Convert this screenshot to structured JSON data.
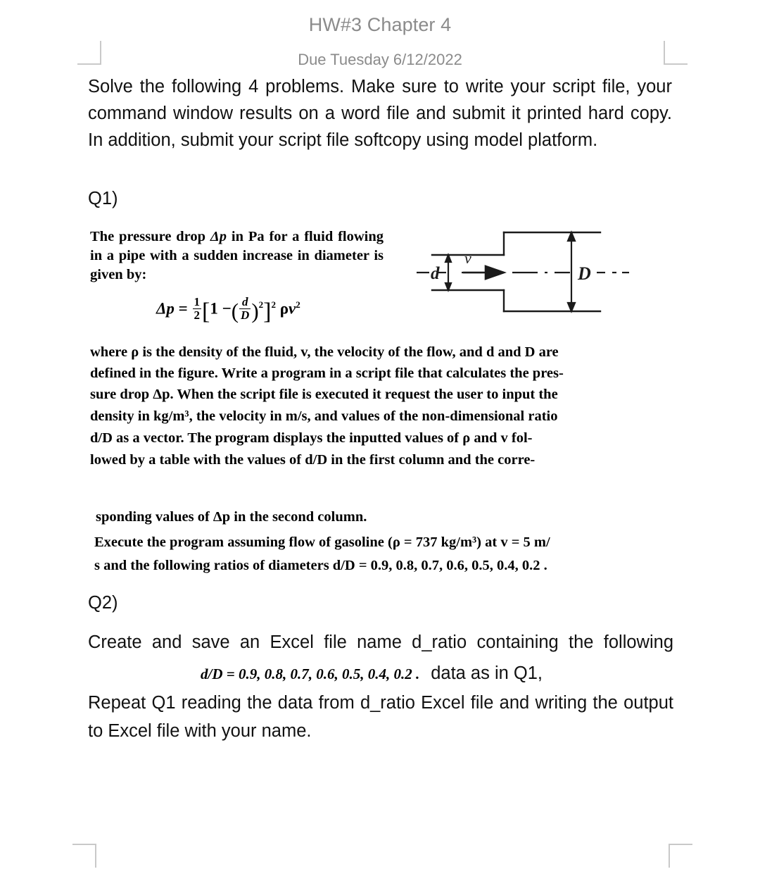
{
  "header": {
    "title": "HW#3 Chapter 4",
    "subtitle": "Due Tuesday 6/12/2022"
  },
  "intro": {
    "text": "Solve the following 4 problems. Make sure to write your script file, your command window results on a word file and submit it printed hard copy. In addition, submit your script file softcopy using model platform."
  },
  "q1": {
    "label": "Q1)",
    "excerpt_line1": "The pressure drop ",
    "excerpt_dp": "Δp",
    "excerpt_line1b": " in Pa for a fluid flowing in a pipe with a sudden increase in diameter is given by:",
    "equation_text": "Δp = 1/2 [ 1 − (d/D)^2 ]^2 ρv^2",
    "equation": {
      "lhs": "Δp",
      "equals": "=",
      "half_num": "1",
      "half_den": "2",
      "bracket_open": "[",
      "one": "1",
      "minus": "−",
      "paren_open": "(",
      "frac_num": "d",
      "frac_den": "D",
      "paren_close": ")",
      "inner_exp": "2",
      "bracket_close": "]",
      "outer_exp": "2",
      "rho": "ρ",
      "v": "v",
      "v_exp": "2"
    },
    "body_p1_l1": "where ρ is the density of the fluid, v, the velocity of the flow, and d and D are",
    "body_p1_l2": "defined in the figure. Write a program in a script file that calculates the pres-",
    "body_p1_l3": "sure drop Δp. When the script file is executed it request the user to input the",
    "body_p2_l1": "density in kg/m³, the velocity in m/s, and values of the non-dimensional ratio",
    "body_p2_l2": "d/D as a vector. The program displays the inputted values of ρ and v fol-",
    "body_p2_l3": "lowed by a table with the values of d/D in the first column and the corre-",
    "body_p3_l1": "sponding values of Δp in the second column.",
    "body_p4_l1": "Execute the program assuming flow of gasoline (ρ = 737 kg/m³) at v = 5 m/",
    "body_p4_l2": "s and the following ratios of diameters d/D = 0.9, 0.8, 0.7, 0.6, 0.5, 0.4, 0.2 .",
    "figure": {
      "label_d": "d",
      "label_D": "D",
      "label_v": "v"
    },
    "values": {
      "density": "737",
      "density_units": "kg/m³",
      "velocity": "5",
      "velocity_units": "m/s",
      "diameter_ratios": "0.9, 0.8, 0.7, 0.6, 0.5, 0.4, 0.2"
    }
  },
  "q2": {
    "label": "Q2)",
    "line1_pre": "Create and save an Excel file name d_ratio containing the following",
    "ratio_formula": "d/D = 0.9, 0.8, 0.7, 0.6, 0.5, 0.4, 0.2 .",
    "line1_post": "data as in Q1,",
    "line2": "Repeat Q1 reading the data from d_ratio Excel file and writing the output to Excel file with your name."
  }
}
